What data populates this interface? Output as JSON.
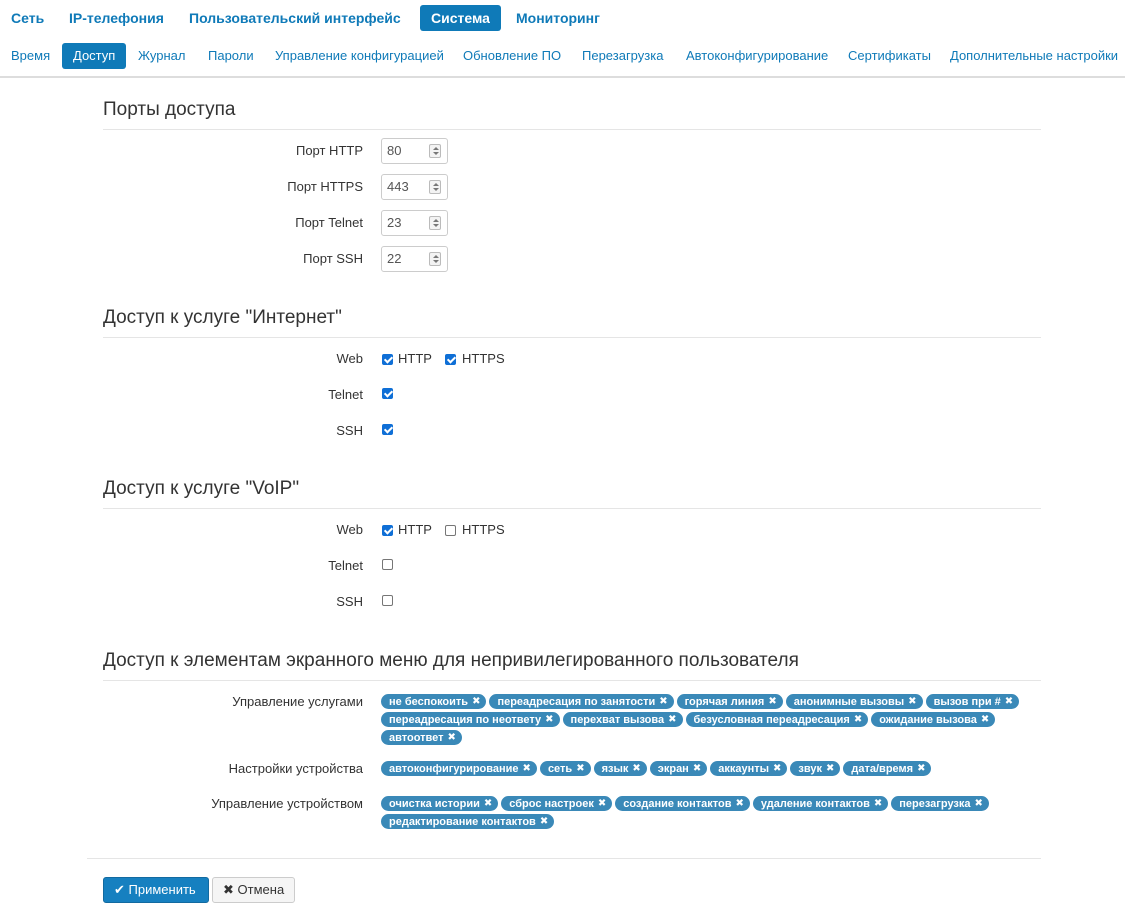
{
  "topnav": [
    {
      "label": "Сеть",
      "active": false
    },
    {
      "label": "IP-телефония",
      "active": false
    },
    {
      "label": "Пользовательский интерфейс",
      "active": false
    },
    {
      "label": "Система",
      "active": true
    },
    {
      "label": "Мониторинг",
      "active": false
    }
  ],
  "subnav": [
    {
      "label": "Время",
      "active": false
    },
    {
      "label": "Доступ",
      "active": true
    },
    {
      "label": "Журнал",
      "active": false
    },
    {
      "label": "Пароли",
      "active": false
    },
    {
      "label": "Управление конфигурацией",
      "active": false
    },
    {
      "label": "Обновление ПО",
      "active": false
    },
    {
      "label": "Перезагрузка",
      "active": false
    },
    {
      "label": "Автоконфигурирование",
      "active": false
    },
    {
      "label": "Сертификаты",
      "active": false
    },
    {
      "label": "Дополнительные настройки",
      "active": false
    }
  ],
  "ports": {
    "title": "Порты доступа",
    "http_label": "Порт HTTP",
    "http_value": "80",
    "https_label": "Порт HTTPS",
    "https_value": "443",
    "telnet_label": "Порт Telnet",
    "telnet_value": "23",
    "ssh_label": "Порт SSH",
    "ssh_value": "22"
  },
  "internet": {
    "title": "Доступ к услуге \"Интернет\"",
    "web_label": "Web",
    "http_label": "HTTP",
    "http_checked": true,
    "https_label": "HTTPS",
    "https_checked": true,
    "telnet_label": "Telnet",
    "telnet_checked": true,
    "ssh_label": "SSH",
    "ssh_checked": true
  },
  "voip": {
    "title": "Доступ к услуге \"VoIP\"",
    "web_label": "Web",
    "http_label": "HTTP",
    "http_checked": true,
    "https_label": "HTTPS",
    "https_checked": false,
    "telnet_label": "Telnet",
    "telnet_checked": false,
    "ssh_label": "SSH",
    "ssh_checked": false
  },
  "menu_access": {
    "title": "Доступ к элементам экранного меню для непривилегированного пользователя",
    "services_label": "Управление услугами",
    "services": [
      "не беспокоить",
      "переадресация по занятости",
      "горячая линия",
      "анонимные вызовы",
      "вызов при #",
      "переадресация по неответу",
      "перехват вызова",
      "безусловная переадресация",
      "ожидание вызова",
      "автоответ"
    ],
    "settings_label": "Настройки устройства",
    "settings": [
      "автоконфигурирование",
      "сеть",
      "язык",
      "экран",
      "аккаунты",
      "звук",
      "дата/время"
    ],
    "device_label": "Управление устройством",
    "device": [
      "очистка истории",
      "сброс настроек",
      "создание контактов",
      "удаление контактов",
      "перезагрузка",
      "редактирование контактов"
    ],
    "remove_glyph": "✖"
  },
  "buttons": {
    "apply_icon": "✔",
    "apply_label": "Применить",
    "cancel_icon": "✖",
    "cancel_label": "Отмена"
  },
  "colors": {
    "accent": "#0f7ab8",
    "tag": "#3a89b8",
    "checkbox": "#0f6fd6"
  }
}
